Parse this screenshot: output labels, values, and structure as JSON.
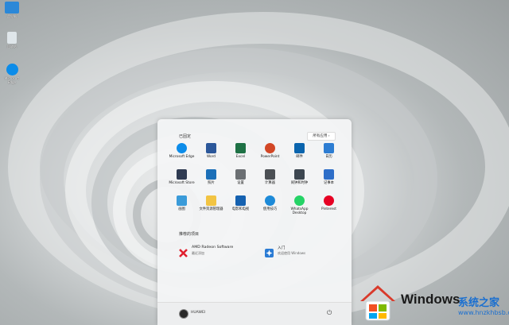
{
  "desktop": {
    "icons": [
      {
        "label": "此电脑",
        "icon": "computer-icon",
        "color": "#2b88d8"
      },
      {
        "label": "回收站",
        "icon": "recycle-bin-icon",
        "color": "#cfd8dc"
      },
      {
        "label": "Microsoft Edge",
        "icon": "edge-icon",
        "color": "#0c8ce9"
      }
    ]
  },
  "start_menu": {
    "pinned_title": "已固定",
    "all_apps_label": "所有应用  ›",
    "pinned": [
      {
        "label": "Microsoft Edge",
        "icon": "edge-icon",
        "color": "#0c8ce9"
      },
      {
        "label": "Word",
        "icon": "word-icon",
        "color": "#2b579a"
      },
      {
        "label": "Excel",
        "icon": "excel-icon",
        "color": "#1e7145"
      },
      {
        "label": "PowerPoint",
        "icon": "powerpoint-icon",
        "color": "#d24726"
      },
      {
        "label": "邮件",
        "icon": "mail-icon",
        "color": "#0a64ad"
      },
      {
        "label": "日历",
        "icon": "calendar-icon",
        "color": "#2d7dd2"
      },
      {
        "label": "Microsoft Store",
        "icon": "store-icon",
        "color": "#2f3b52"
      },
      {
        "label": "照片",
        "icon": "photos-icon",
        "color": "#1b6fb8"
      },
      {
        "label": "设置",
        "icon": "settings-gear-icon",
        "color": "#6b6f73"
      },
      {
        "label": "计算器",
        "icon": "calculator-icon",
        "color": "#4b4f54"
      },
      {
        "label": "闹钟和时钟",
        "icon": "clock-icon",
        "color": "#3c4650"
      },
      {
        "label": "记事本",
        "icon": "notepad-icon",
        "color": "#2d6ec8"
      },
      {
        "label": "画图",
        "icon": "paint-icon",
        "color": "#3a9bd9"
      },
      {
        "label": "文件资源管理器",
        "icon": "folder-icon",
        "color": "#f2c443"
      },
      {
        "label": "电影和电视",
        "icon": "movies-icon",
        "color": "#1561b0"
      },
      {
        "label": "使用技巧",
        "icon": "tips-icon",
        "color": "#1d8ad8"
      },
      {
        "label": "WhatsApp Desktop",
        "icon": "whatsapp-icon",
        "color": "#25d366"
      },
      {
        "label": "Pinterest",
        "icon": "pinterest-icon",
        "color": "#e60023"
      }
    ],
    "recommended_title": "推荐的项目",
    "recommended": [
      {
        "title": "AMD Radeon Software",
        "subtitle": "最近添加",
        "icon": "amd-radeon-icon",
        "color": "#e01f2d"
      },
      {
        "title": "入门",
        "subtitle": "欢迎使用 Windows",
        "icon": "get-started-icon",
        "color": "#2a7bd4"
      }
    ],
    "user_name": "HUAWEI",
    "power_glyph": "⏻"
  },
  "watermark": {
    "brand": "Windows",
    "site_name": "系统之家",
    "url": "www.hnzkhbsb.com"
  }
}
